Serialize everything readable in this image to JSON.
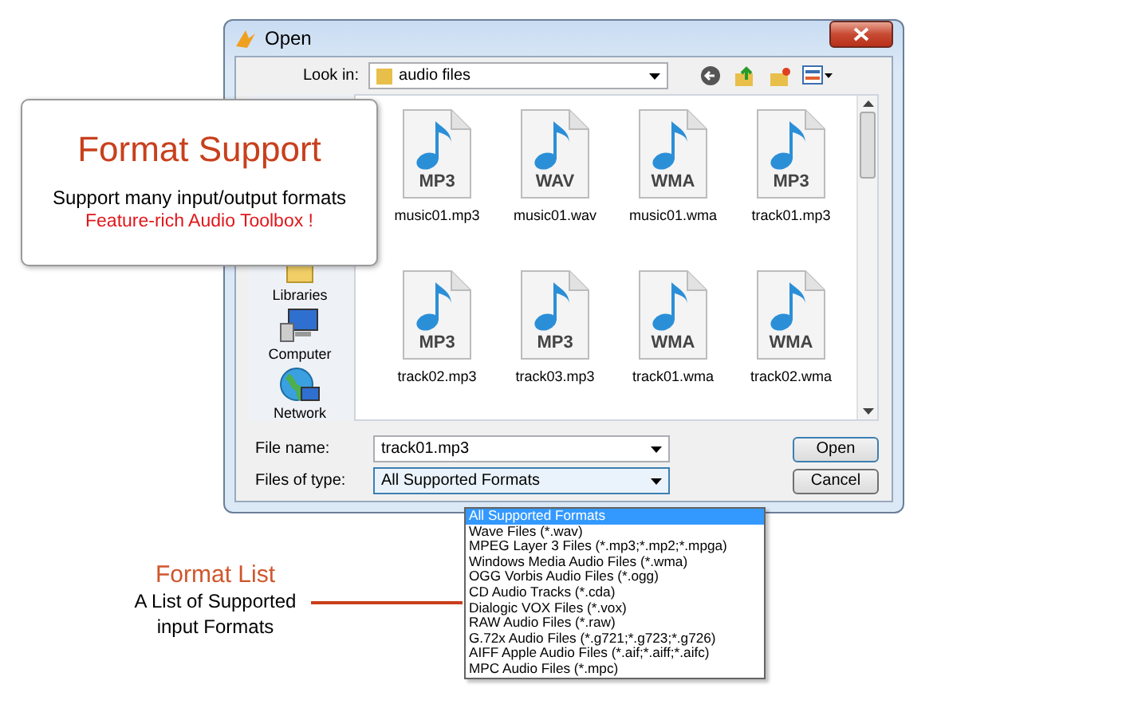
{
  "window": {
    "title": "Open"
  },
  "look_in": {
    "label": "Look in:",
    "value": "audio files"
  },
  "sidebar": {
    "items": [
      {
        "label": "Libraries",
        "kind": "library"
      },
      {
        "label": "Computer",
        "kind": "computer"
      },
      {
        "label": "Network",
        "kind": "network"
      }
    ]
  },
  "files": [
    {
      "name": "music01.mp3",
      "format": "MP3"
    },
    {
      "name": "music01.wav",
      "format": "WAV"
    },
    {
      "name": "music01.wma",
      "format": "WMA"
    },
    {
      "name": "track01.mp3",
      "format": "MP3"
    },
    {
      "name": "track02.mp3",
      "format": "MP3"
    },
    {
      "name": "track03.mp3",
      "format": "MP3"
    },
    {
      "name": "track01.wma",
      "format": "WMA"
    },
    {
      "name": "track02.wma",
      "format": "WMA"
    }
  ],
  "file_name": {
    "label": "File name:",
    "value": "track01.mp3"
  },
  "file_type": {
    "label": "Files of type:",
    "value": "All Supported Formats",
    "expanded": true
  },
  "buttons": [
    "Open",
    "Cancel"
  ],
  "type_options": [
    {
      "label": "All Supported Formats",
      "selected": true
    },
    {
      "label": "Wave Files (*.wav)",
      "selected": false
    },
    {
      "label": "MPEG Layer 3 Files (*.mp3;*.mp2;*.mpga)",
      "selected": false
    },
    {
      "label": "Windows Media Audio Files (*.wma)",
      "selected": false
    },
    {
      "label": "OGG Vorbis Audio Files (*.ogg)",
      "selected": false
    },
    {
      "label": "CD Audio Tracks (*.cda)",
      "selected": false
    },
    {
      "label": "Dialogic VOX Files (*.vox)",
      "selected": false
    },
    {
      "label": "RAW Audio Files (*.raw)",
      "selected": false
    },
    {
      "label": "G.72x Audio Files (*.g721;*.g723;*.g726)",
      "selected": false
    },
    {
      "label": "AIFF Apple Audio Files (*.aif;*.aiff;*.aifc)",
      "selected": false
    },
    {
      "label": "MPC Audio Files (*.mpc)",
      "selected": false
    }
  ],
  "support_callout": {
    "title": "Format Support",
    "text": "Support many input/output formats",
    "highlight": "Feature-rich Audio Toolbox !"
  },
  "list_callout": {
    "title": "Format List",
    "text": "A List of Supported input Formats"
  }
}
